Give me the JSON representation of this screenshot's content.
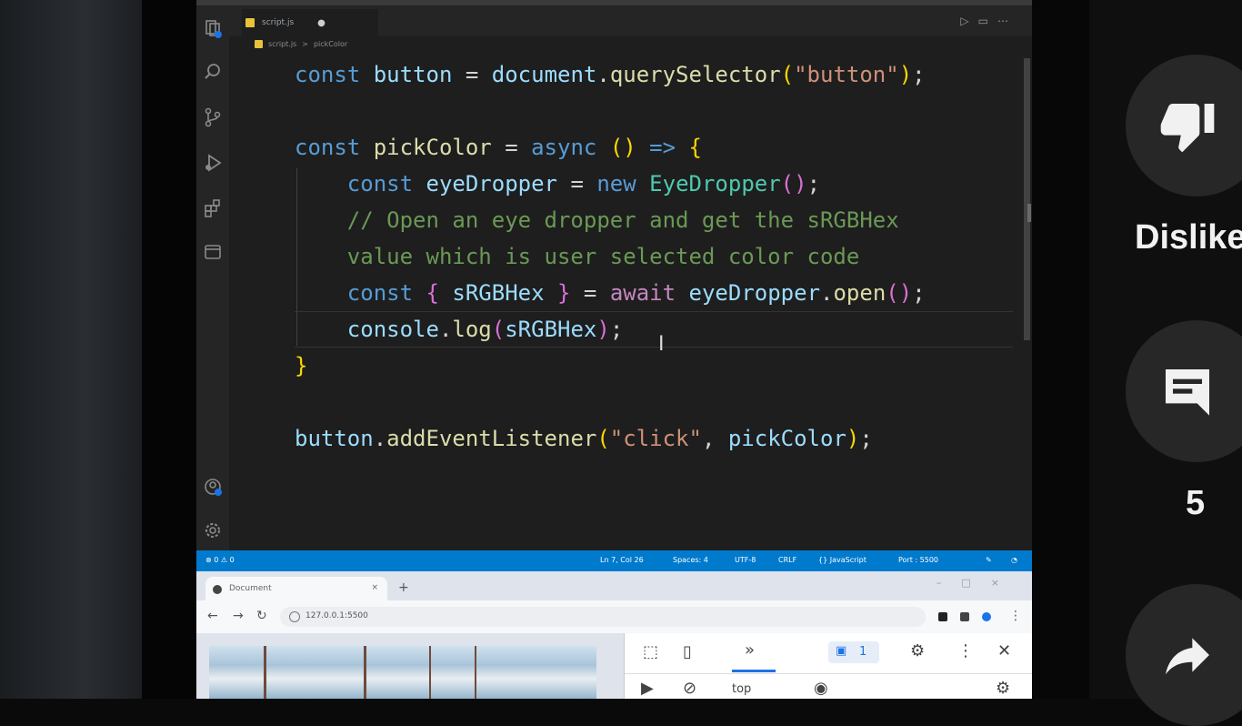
{
  "editor": {
    "tab": {
      "filename": "script.js",
      "modified_dot": "●"
    },
    "breadcrumb": {
      "file": "script.js",
      "separator": ">",
      "symbol": "pickColor"
    },
    "code_lines": [
      "const button = document.querySelector(\"button\");",
      "",
      "const pickColor = async () => {",
      "    const eyeDropper = new EyeDropper();",
      "    // Open an eye dropper and get the sRGBHex",
      "    value which is user selected color code",
      "    const { sRGBHex } = await eyeDropper.open();",
      "    console.log(sRGBHex);",
      "}",
      "",
      "button.addEventListener(\"click\", pickColor);"
    ]
  },
  "statusbar": {
    "left": "⊗ 0 ⚠ 0",
    "position": "Ln 7, Col 26",
    "spaces": "Spaces: 4",
    "encoding": "UTF-8",
    "eol": "CRLF",
    "language": "{} JavaScript",
    "port": "Port : 5500"
  },
  "browser": {
    "tab_title": "Document",
    "tab_close": "×",
    "new_tab": "+",
    "url": "127.0.0.1:5500",
    "devtools": {
      "more_tabs": "»",
      "messages_count": "1",
      "context": "top"
    }
  },
  "youtube": {
    "dislike_label": "Dislike",
    "comments_count": "5"
  },
  "colors": {
    "vscode_bg": "#1e1e1e",
    "statusbar": "#007acc",
    "keyword": "#569cd6",
    "string": "#ce9178",
    "comment": "#6a9955"
  }
}
